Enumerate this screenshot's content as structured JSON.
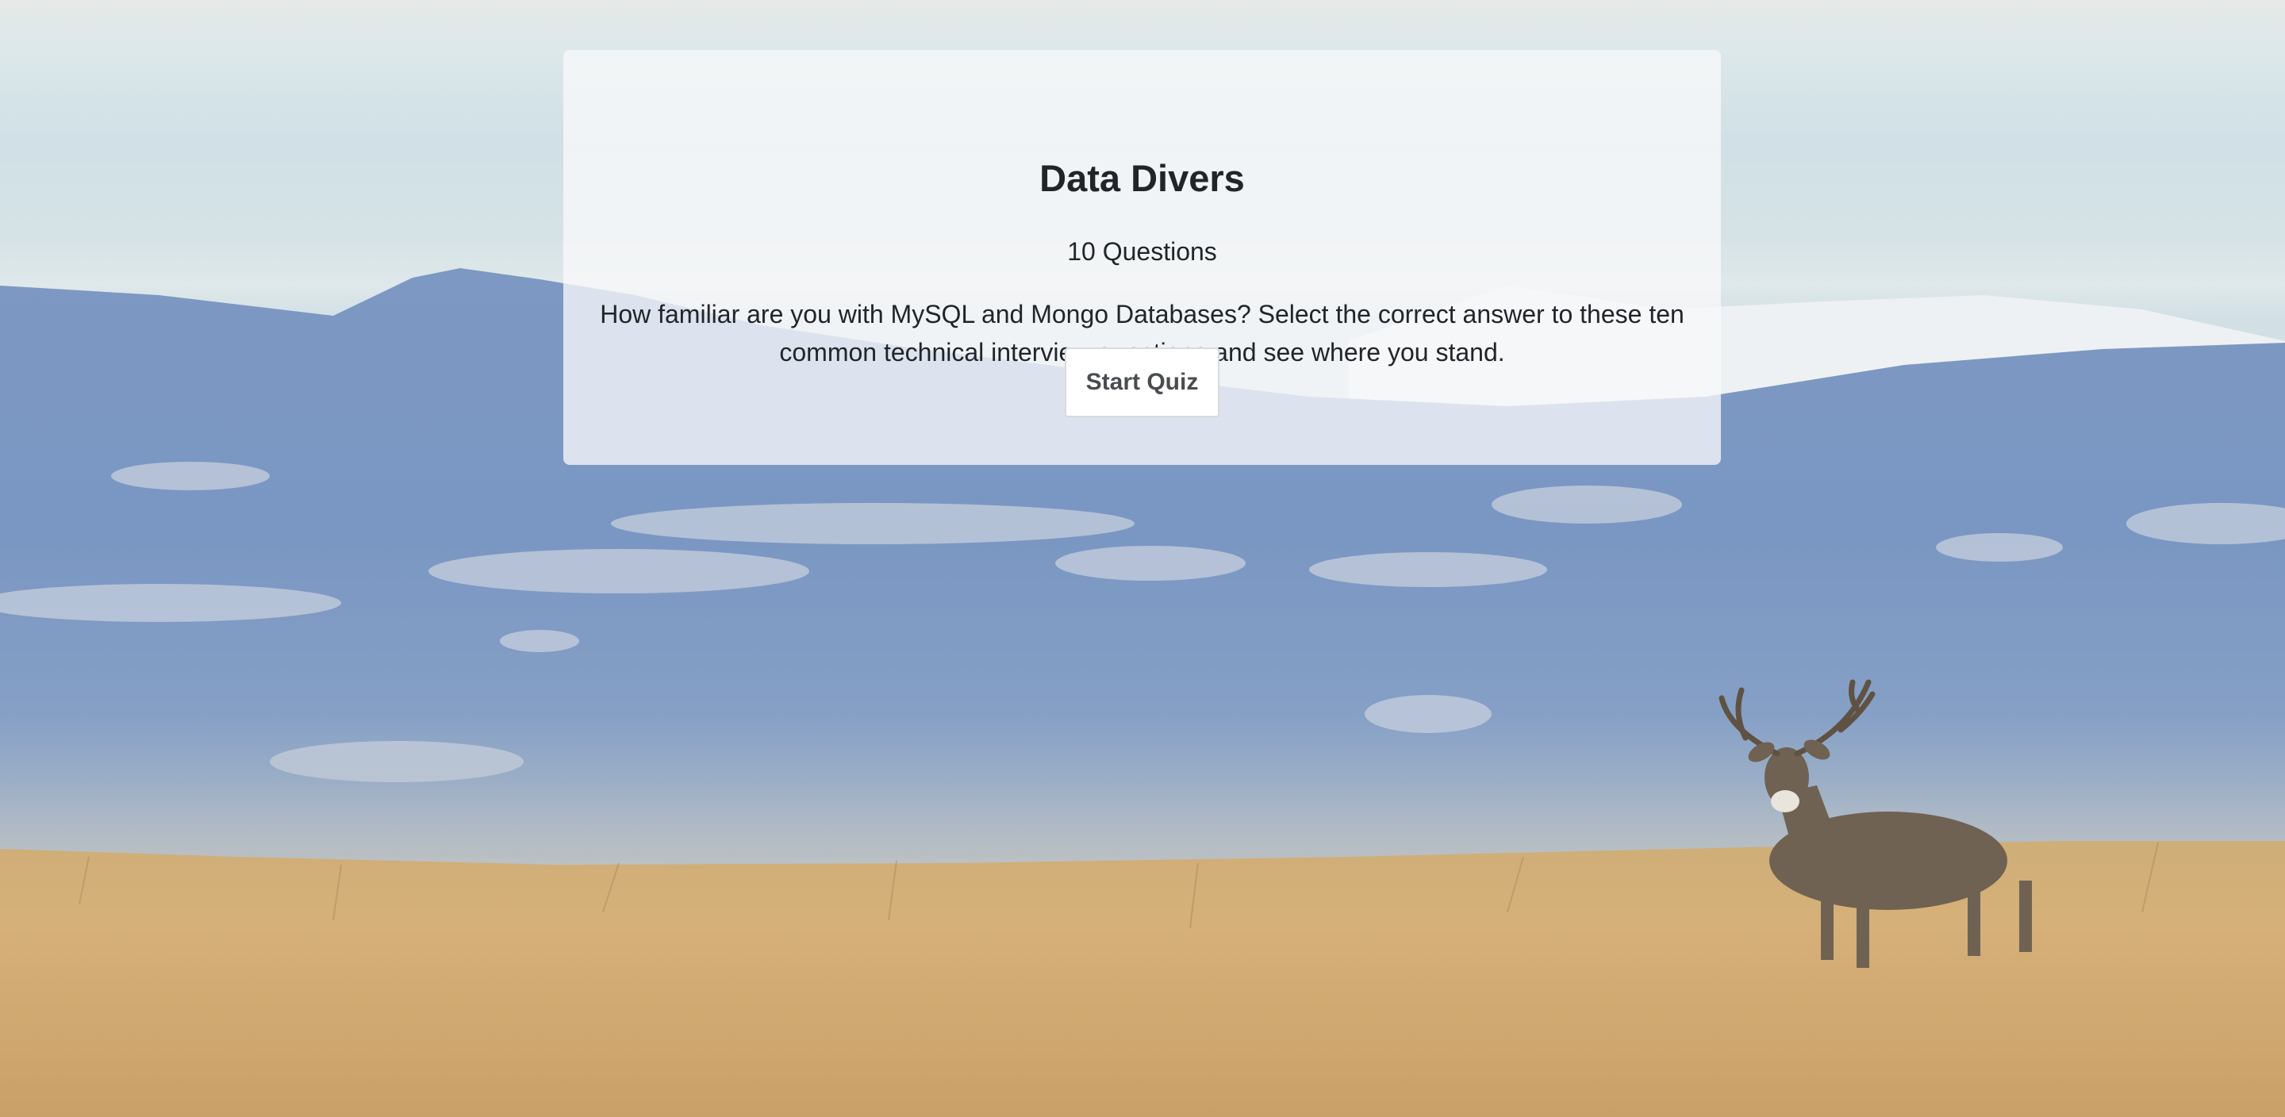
{
  "quiz": {
    "title": "Data Divers",
    "question_count": "10 Questions",
    "description": "How familiar are you with MySQL and Mongo Databases? Select the correct answer to these ten common technical interview questions and see where you stand.",
    "start_label": "Start Quiz"
  },
  "background": {
    "subject": "mule deer stag in golden grass field with blue mountains",
    "colors": {
      "sky": "#dce8ea",
      "mountains": "#7f9cc4",
      "grass": "#d2ab6e",
      "deer": "#7a6a58"
    }
  }
}
